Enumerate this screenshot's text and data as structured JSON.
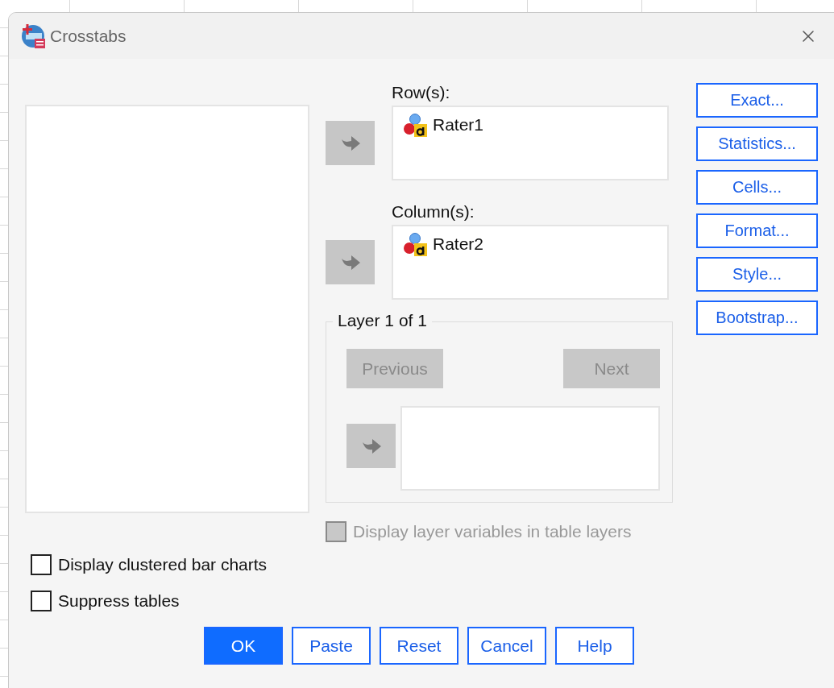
{
  "window": {
    "title": "Crosstabs"
  },
  "rows": {
    "label": "Row(s):",
    "arrow_disabled": true,
    "items": [
      {
        "name": "Rater1"
      }
    ]
  },
  "columns": {
    "label": "Column(s):",
    "arrow_disabled": true,
    "items": [
      {
        "name": "Rater2"
      }
    ]
  },
  "side_buttons": [
    {
      "label": "Exact..."
    },
    {
      "label": "Statistics..."
    },
    {
      "label": "Cells..."
    },
    {
      "label": "Format..."
    },
    {
      "label": "Style..."
    },
    {
      "label": "Bootstrap..."
    }
  ],
  "layer": {
    "title": "Layer 1 of 1",
    "previous": {
      "label": "Previous",
      "disabled": true
    },
    "next": {
      "label": "Next",
      "disabled": true
    },
    "arrow_disabled": true
  },
  "display_layer_option": {
    "label": "Display layer variables in table layers",
    "checked": false,
    "disabled": true
  },
  "options": [
    {
      "label": "Display clustered bar charts",
      "checked": false
    },
    {
      "label": "Suppress tables",
      "checked": false
    }
  ],
  "footer_buttons": [
    {
      "label": "OK",
      "default": true
    },
    {
      "label": "Paste",
      "default": false
    },
    {
      "label": "Reset",
      "default": false
    },
    {
      "label": "Cancel",
      "default": false
    },
    {
      "label": "Help",
      "default": false
    }
  ]
}
